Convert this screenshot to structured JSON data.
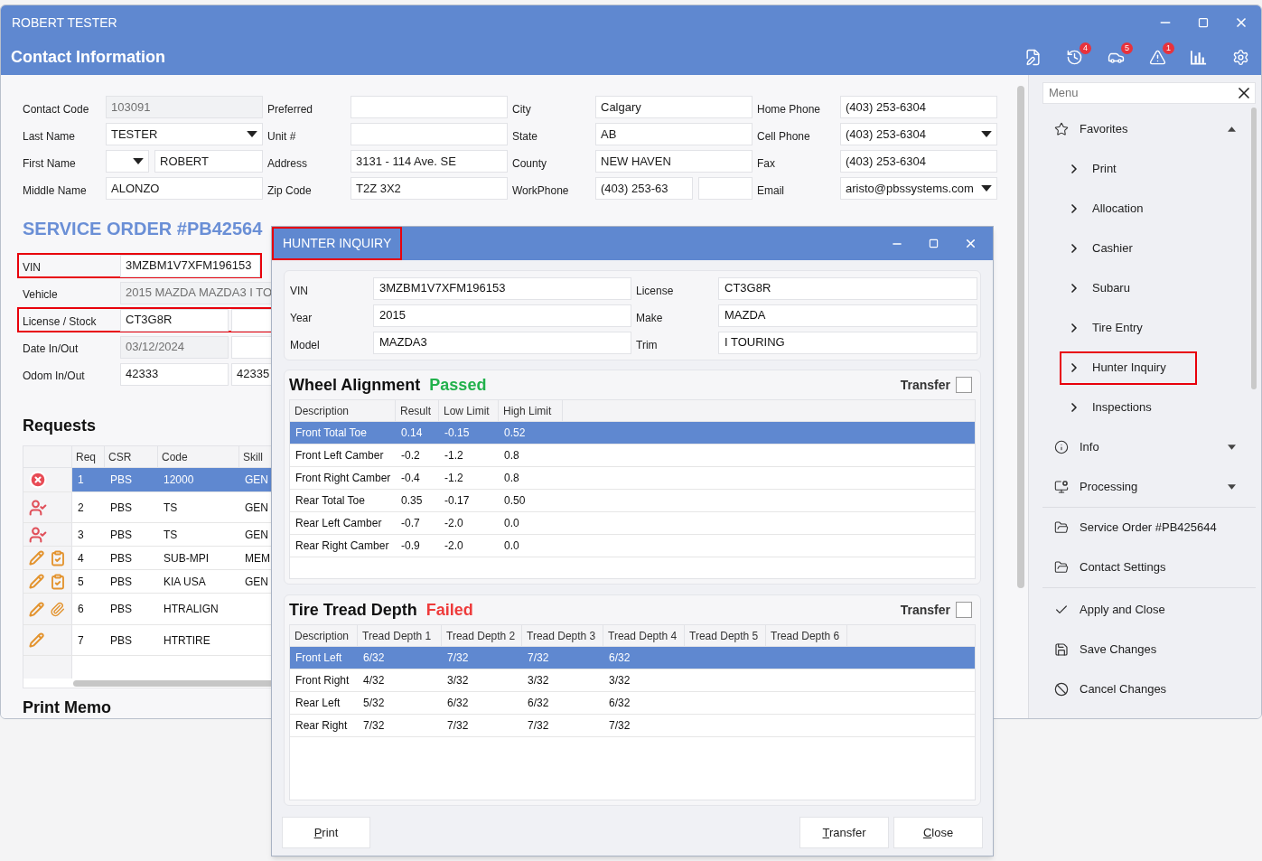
{
  "window": {
    "user": "ROBERT TESTER",
    "title": "Contact Information"
  },
  "toolbar": [
    {
      "kind": "edit"
    },
    {
      "kind": "history",
      "badge": "4"
    },
    {
      "kind": "car",
      "badge": "5"
    },
    {
      "kind": "warning",
      "badge": "1"
    },
    {
      "kind": "chart"
    },
    {
      "kind": "gears"
    }
  ],
  "contact": [
    [
      {
        "label": "Contact Code",
        "fields": [
          {
            "value": "103091",
            "readonly": true
          }
        ]
      },
      {
        "label": "Preferred",
        "fields": [
          {
            "readonly": false
          }
        ]
      },
      {
        "label": "City",
        "fields": [
          {
            "value": "Calgary",
            "readonly": false
          }
        ]
      },
      {
        "label": "Home Phone",
        "fields": [
          {
            "value": "(403) 253-6304",
            "readonly": false
          }
        ]
      }
    ],
    [
      {
        "label": "Last Name",
        "fields": [
          {
            "value": "TESTER",
            "dropdown": true,
            "readonly": false
          }
        ]
      },
      {
        "label": "Unit #",
        "fields": [
          {
            "readonly": false
          }
        ]
      },
      {
        "label": "State",
        "fields": [
          {
            "value": "AB",
            "readonly": false
          }
        ]
      },
      {
        "label": "Cell Phone",
        "fields": [
          {
            "value": "(403) 253-6304",
            "dropdown": true,
            "readonly": false
          }
        ]
      }
    ],
    [
      {
        "label": "First Name",
        "fields": [
          {
            "dropdown": true,
            "readonly": false
          },
          {
            "value": "ROBERT",
            "readonly": false
          }
        ]
      },
      {
        "label": "Address",
        "fields": [
          {
            "value": "3131 - 114 Ave. SE",
            "readonly": false
          }
        ]
      },
      {
        "label": "County",
        "fields": [
          {
            "value": "NEW HAVEN",
            "readonly": false
          }
        ]
      },
      {
        "label": "Fax",
        "fields": [
          {
            "value": "(403) 253-6304",
            "readonly": false
          }
        ]
      }
    ],
    [
      {
        "label": "Middle Name",
        "fields": [
          {
            "value": "ALONZO",
            "readonly": false
          }
        ]
      },
      {
        "label": "Zip Code",
        "fields": [
          {
            "value": "T2Z 3X2",
            "readonly": false
          }
        ]
      },
      {
        "label": "WorkPhone",
        "fields": [
          {
            "value": "(403) 253-63",
            "readonly": false
          },
          {
            "readonly": false
          }
        ]
      },
      {
        "label": "Email",
        "fields": [
          {
            "value": "aristo@pbssystems.com",
            "dropdown": true,
            "readonly": false
          }
        ]
      }
    ]
  ],
  "service_order": {
    "title": "SERVICE ORDER #PB42564",
    "fields": [
      {
        "label": "VIN",
        "highlighted": true,
        "fields": [
          {
            "value": "3MZBM1V7XFM196153",
            "readonly": false
          }
        ]
      },
      {
        "label": "Vehicle",
        "highlighted": false,
        "fields": [
          {
            "value": "2015 MAZDA MAZDA3 I TO",
            "readonly": true
          }
        ]
      },
      {
        "label": "License / Stock",
        "highlighted": true,
        "fields": [
          {
            "value": "CT3G8R",
            "readonly": false
          },
          {
            "readonly": false
          }
        ]
      },
      {
        "label": "Date In/Out",
        "highlighted": false,
        "fields": [
          {
            "value": "03/12/2024",
            "readonly": true
          },
          {
            "readonly": false
          }
        ]
      },
      {
        "label": "Odom In/Out",
        "highlighted": false,
        "fields": [
          {
            "value": "42333",
            "readonly": false
          },
          {
            "value": "42335",
            "readonly": false
          }
        ]
      }
    ],
    "requests": {
      "title": "Requests",
      "columns": [
        "Req",
        "CSR",
        "Code",
        "Skill"
      ],
      "rows": [
        {
          "selected": true,
          "icons": [
            {
              "kind": "error"
            }
          ],
          "cells": [
            "1",
            "PBS",
            "12000",
            "GEN"
          ]
        },
        {
          "selected": false,
          "icons": [
            {
              "kind": "user-check"
            }
          ],
          "cells": [
            "2",
            "PBS",
            "TS",
            "GEN"
          ]
        },
        {
          "selected": false,
          "icons": [
            {
              "kind": "user-check"
            }
          ],
          "cells": [
            "3",
            "PBS",
            "TS",
            "GEN"
          ]
        },
        {
          "selected": false,
          "icons": [
            {
              "kind": "pencil"
            },
            {
              "kind": "clipboard"
            }
          ],
          "cells": [
            "4",
            "PBS",
            "SUB-MPI",
            "MEM"
          ]
        },
        {
          "selected": false,
          "icons": [
            {
              "kind": "pencil"
            },
            {
              "kind": "clipboard"
            }
          ],
          "cells": [
            "5",
            "PBS",
            "KIA USA",
            "GEN"
          ]
        },
        {
          "selected": false,
          "icons": [
            {
              "kind": "pencil"
            },
            {
              "kind": "paperclip"
            }
          ],
          "cells": [
            "6",
            "PBS",
            "HTRALIGN"
          ]
        },
        {
          "selected": false,
          "icons": [
            {
              "kind": "pencil"
            }
          ],
          "cells": [
            "7",
            "PBS",
            "HTRTIRE"
          ]
        }
      ]
    },
    "memo_title": "Print Memo"
  },
  "menu": {
    "placeholder": "Menu",
    "groups": [
      [
        {
          "kind": "star",
          "label": "Favorites",
          "expanded": true,
          "children": [
            {
              "label": "Print",
              "highlighted": false
            },
            {
              "label": "Allocation",
              "highlighted": false
            },
            {
              "label": "Cashier",
              "highlighted": false
            },
            {
              "label": "Subaru",
              "highlighted": false
            },
            {
              "label": "Tire Entry",
              "highlighted": false
            },
            {
              "label": "Hunter Inquiry",
              "highlighted": true
            },
            {
              "label": "Inspections",
              "highlighted": false
            }
          ]
        },
        {
          "kind": "info",
          "label": "Info",
          "expanded": false
        },
        {
          "kind": "processing",
          "label": "Processing",
          "expanded": false
        }
      ],
      [
        {
          "kind": "folder",
          "label": "Service Order #PB425644"
        },
        {
          "kind": "folder",
          "label": "Contact Settings"
        }
      ],
      [
        {
          "kind": "check",
          "label": "Apply and Close"
        },
        {
          "kind": "save",
          "label": "Save Changes"
        },
        {
          "kind": "cancel",
          "label": "Cancel Changes"
        }
      ]
    ]
  },
  "dialog": {
    "title": "HUNTER INQUIRY",
    "highlighted": true,
    "vehicle": [
      {
        "label": "VIN",
        "value": "3MZBM1V7XFM196153"
      },
      {
        "label": "License",
        "value": "CT3G8R"
      },
      {
        "label": "Year",
        "value": "2015"
      },
      {
        "label": "Make",
        "value": "MAZDA"
      },
      {
        "label": "Model",
        "value": "MAZDA3"
      },
      {
        "label": "Trim",
        "value": "I TOURING"
      }
    ],
    "sections": [
      {
        "title": "Wheel Alignment",
        "status": "Passed",
        "kind": "passed",
        "transfer_label": "Transfer",
        "transfer_checked": false,
        "columns": [
          "Description",
          "Result",
          "Low Limit",
          "High Limit"
        ],
        "rows": [
          {
            "selected": true,
            "cells": [
              "Front Total Toe",
              "0.14",
              "-0.15",
              "0.52"
            ]
          },
          {
            "selected": false,
            "cells": [
              "Front Left Camber",
              "-0.2",
              "-1.2",
              "0.8"
            ]
          },
          {
            "selected": false,
            "cells": [
              "Front Right Camber",
              "-0.4",
              "-1.2",
              "0.8"
            ]
          },
          {
            "selected": false,
            "cells": [
              "Rear Total Toe",
              "0.35",
              "-0.17",
              "0.50"
            ]
          },
          {
            "selected": false,
            "cells": [
              "Rear Left Camber",
              "-0.7",
              "-2.0",
              "0.0"
            ]
          },
          {
            "selected": false,
            "cells": [
              "Rear Right Camber",
              "-0.9",
              "-2.0",
              "0.0"
            ]
          }
        ]
      },
      {
        "title": "Tire Tread Depth",
        "status": "Failed",
        "kind": "failed",
        "transfer_label": "Transfer",
        "transfer_checked": false,
        "columns": [
          "Description",
          "Tread Depth 1",
          "Tread Depth 2",
          "Tread Depth 3",
          "Tread Depth 4",
          "Tread Depth 5",
          "Tread Depth 6"
        ],
        "rows": [
          {
            "selected": true,
            "cells": [
              "Front Left",
              "6/32",
              "7/32",
              "7/32",
              "6/32"
            ]
          },
          {
            "selected": false,
            "cells": [
              "Front Right",
              "4/32",
              "3/32",
              "3/32",
              "3/32"
            ]
          },
          {
            "selected": false,
            "cells": [
              "Rear Left",
              "5/32",
              "6/32",
              "6/32",
              "6/32"
            ]
          },
          {
            "selected": false,
            "cells": [
              "Rear Right",
              "7/32",
              "7/32",
              "7/32",
              "7/32"
            ]
          }
        ]
      }
    ],
    "left_buttons": [
      "Print"
    ],
    "right_buttons": [
      "Transfer",
      "Close"
    ]
  }
}
